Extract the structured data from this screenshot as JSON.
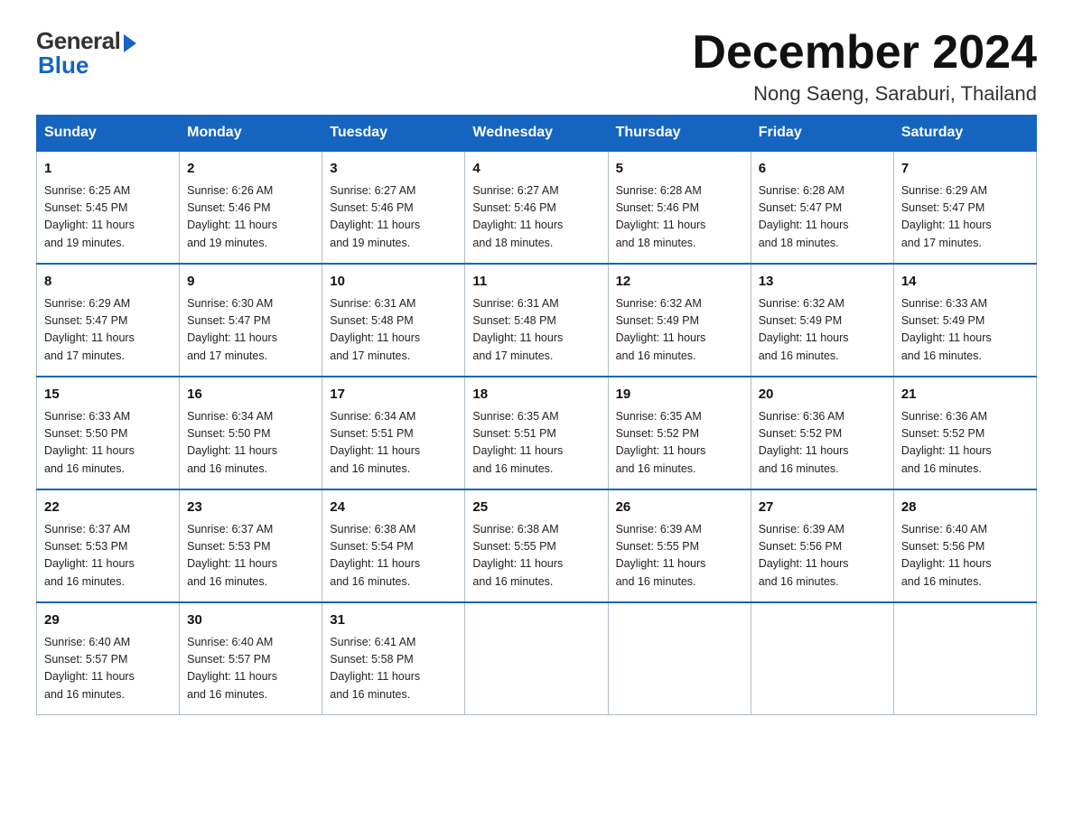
{
  "logo": {
    "general": "General",
    "blue": "Blue"
  },
  "header": {
    "month": "December 2024",
    "location": "Nong Saeng, Saraburi, Thailand"
  },
  "days_of_week": [
    "Sunday",
    "Monday",
    "Tuesday",
    "Wednesday",
    "Thursday",
    "Friday",
    "Saturday"
  ],
  "weeks": [
    [
      {
        "day": "1",
        "sunrise": "6:25 AM",
        "sunset": "5:45 PM",
        "daylight": "11 hours and 19 minutes."
      },
      {
        "day": "2",
        "sunrise": "6:26 AM",
        "sunset": "5:46 PM",
        "daylight": "11 hours and 19 minutes."
      },
      {
        "day": "3",
        "sunrise": "6:27 AM",
        "sunset": "5:46 PM",
        "daylight": "11 hours and 19 minutes."
      },
      {
        "day": "4",
        "sunrise": "6:27 AM",
        "sunset": "5:46 PM",
        "daylight": "11 hours and 18 minutes."
      },
      {
        "day": "5",
        "sunrise": "6:28 AM",
        "sunset": "5:46 PM",
        "daylight": "11 hours and 18 minutes."
      },
      {
        "day": "6",
        "sunrise": "6:28 AM",
        "sunset": "5:47 PM",
        "daylight": "11 hours and 18 minutes."
      },
      {
        "day": "7",
        "sunrise": "6:29 AM",
        "sunset": "5:47 PM",
        "daylight": "11 hours and 17 minutes."
      }
    ],
    [
      {
        "day": "8",
        "sunrise": "6:29 AM",
        "sunset": "5:47 PM",
        "daylight": "11 hours and 17 minutes."
      },
      {
        "day": "9",
        "sunrise": "6:30 AM",
        "sunset": "5:47 PM",
        "daylight": "11 hours and 17 minutes."
      },
      {
        "day": "10",
        "sunrise": "6:31 AM",
        "sunset": "5:48 PM",
        "daylight": "11 hours and 17 minutes."
      },
      {
        "day": "11",
        "sunrise": "6:31 AM",
        "sunset": "5:48 PM",
        "daylight": "11 hours and 17 minutes."
      },
      {
        "day": "12",
        "sunrise": "6:32 AM",
        "sunset": "5:49 PM",
        "daylight": "11 hours and 16 minutes."
      },
      {
        "day": "13",
        "sunrise": "6:32 AM",
        "sunset": "5:49 PM",
        "daylight": "11 hours and 16 minutes."
      },
      {
        "day": "14",
        "sunrise": "6:33 AM",
        "sunset": "5:49 PM",
        "daylight": "11 hours and 16 minutes."
      }
    ],
    [
      {
        "day": "15",
        "sunrise": "6:33 AM",
        "sunset": "5:50 PM",
        "daylight": "11 hours and 16 minutes."
      },
      {
        "day": "16",
        "sunrise": "6:34 AM",
        "sunset": "5:50 PM",
        "daylight": "11 hours and 16 minutes."
      },
      {
        "day": "17",
        "sunrise": "6:34 AM",
        "sunset": "5:51 PM",
        "daylight": "11 hours and 16 minutes."
      },
      {
        "day": "18",
        "sunrise": "6:35 AM",
        "sunset": "5:51 PM",
        "daylight": "11 hours and 16 minutes."
      },
      {
        "day": "19",
        "sunrise": "6:35 AM",
        "sunset": "5:52 PM",
        "daylight": "11 hours and 16 minutes."
      },
      {
        "day": "20",
        "sunrise": "6:36 AM",
        "sunset": "5:52 PM",
        "daylight": "11 hours and 16 minutes."
      },
      {
        "day": "21",
        "sunrise": "6:36 AM",
        "sunset": "5:52 PM",
        "daylight": "11 hours and 16 minutes."
      }
    ],
    [
      {
        "day": "22",
        "sunrise": "6:37 AM",
        "sunset": "5:53 PM",
        "daylight": "11 hours and 16 minutes."
      },
      {
        "day": "23",
        "sunrise": "6:37 AM",
        "sunset": "5:53 PM",
        "daylight": "11 hours and 16 minutes."
      },
      {
        "day": "24",
        "sunrise": "6:38 AM",
        "sunset": "5:54 PM",
        "daylight": "11 hours and 16 minutes."
      },
      {
        "day": "25",
        "sunrise": "6:38 AM",
        "sunset": "5:55 PM",
        "daylight": "11 hours and 16 minutes."
      },
      {
        "day": "26",
        "sunrise": "6:39 AM",
        "sunset": "5:55 PM",
        "daylight": "11 hours and 16 minutes."
      },
      {
        "day": "27",
        "sunrise": "6:39 AM",
        "sunset": "5:56 PM",
        "daylight": "11 hours and 16 minutes."
      },
      {
        "day": "28",
        "sunrise": "6:40 AM",
        "sunset": "5:56 PM",
        "daylight": "11 hours and 16 minutes."
      }
    ],
    [
      {
        "day": "29",
        "sunrise": "6:40 AM",
        "sunset": "5:57 PM",
        "daylight": "11 hours and 16 minutes."
      },
      {
        "day": "30",
        "sunrise": "6:40 AM",
        "sunset": "5:57 PM",
        "daylight": "11 hours and 16 minutes."
      },
      {
        "day": "31",
        "sunrise": "6:41 AM",
        "sunset": "5:58 PM",
        "daylight": "11 hours and 16 minutes."
      },
      null,
      null,
      null,
      null
    ]
  ],
  "labels": {
    "sunrise": "Sunrise:",
    "sunset": "Sunset:",
    "daylight": "Daylight:"
  }
}
